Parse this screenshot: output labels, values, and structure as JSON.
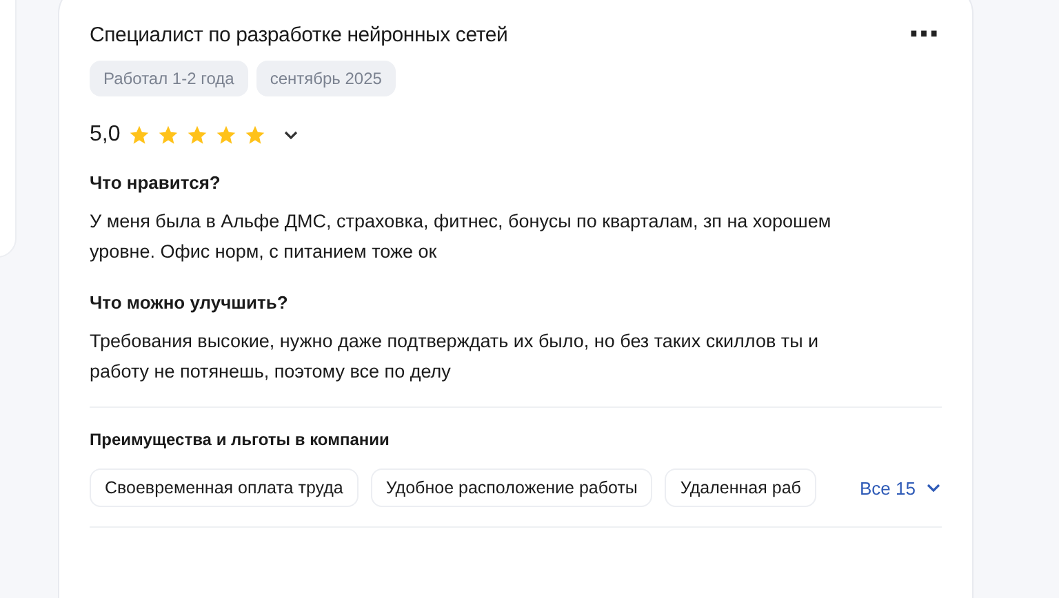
{
  "review": {
    "title": "Специалист по разработке нейронных сетей",
    "more_icon": "⋯",
    "tags": [
      "Работал 1-2 года",
      "сентябрь 2025"
    ],
    "rating": {
      "score": "5,0",
      "stars": 5
    },
    "sections": [
      {
        "heading": "Что нравится?",
        "text": "У меня была в Альфе ДМС, страховка, фитнес, бонусы по кварталам, зп на хорошем уровне. Офис норм, с питанием тоже ок"
      },
      {
        "heading": "Что можно улучшить?",
        "text": "Требования высокие, нужно даже подтверждать их было, но без таких скиллов ты и работу не потянешь, поэтому все по делу"
      }
    ],
    "benefits": {
      "heading": "Преимущества и льготы в компании",
      "items": [
        "Своевременная оплата труда",
        "Удобное расположение работы",
        "Удаленная раб"
      ],
      "show_all": "Все 15"
    }
  }
}
